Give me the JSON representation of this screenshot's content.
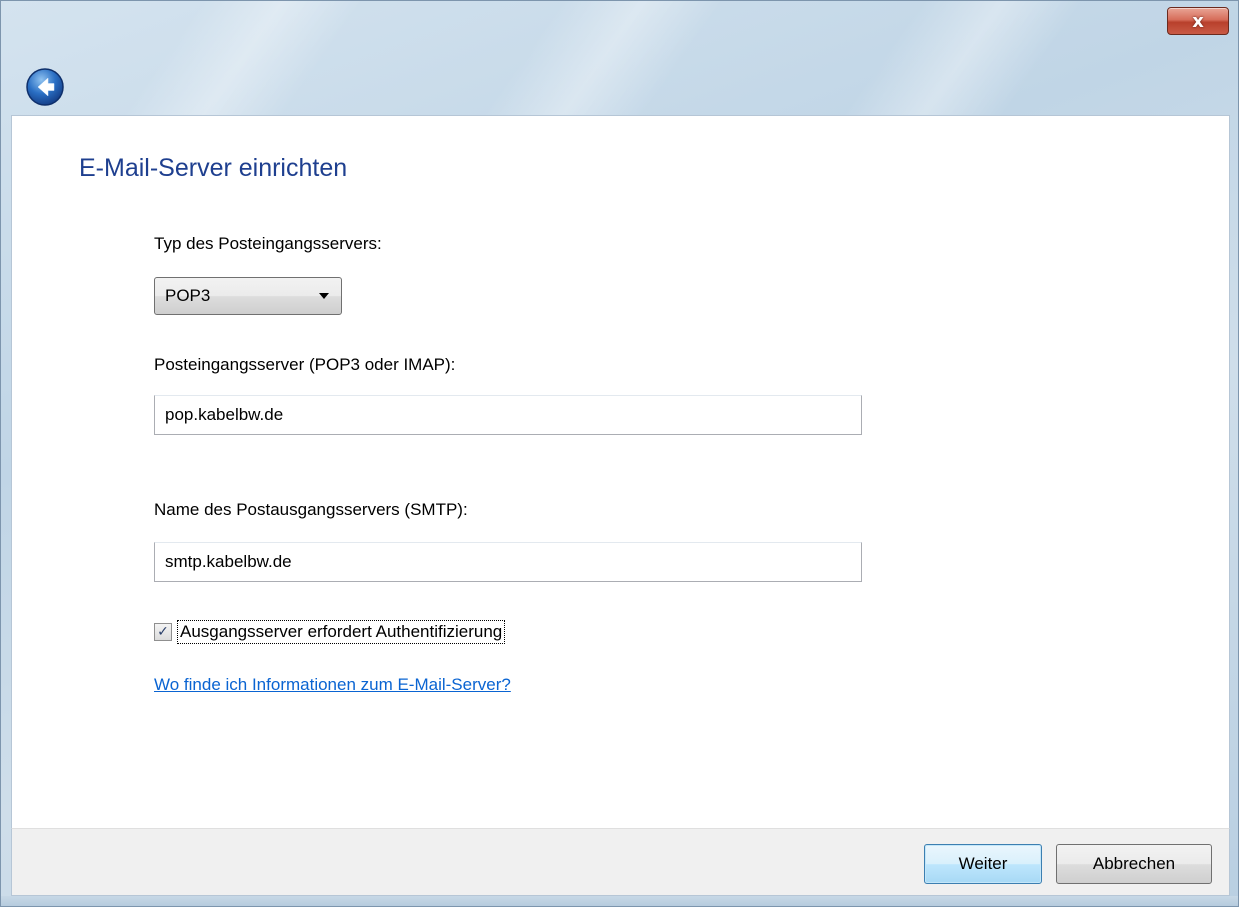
{
  "window": {
    "close_glyph": "x"
  },
  "page": {
    "title": "E-Mail-Server einrichten"
  },
  "form": {
    "incoming_type_label": "Typ des Posteingangsservers:",
    "incoming_type_value": "POP3",
    "incoming_server_label": "Posteingangsserver (POP3 oder IMAP):",
    "incoming_server_value": "pop.kabelbw.de",
    "outgoing_server_label": "Name des Postausgangsservers (SMTP):",
    "outgoing_server_value": "smtp.kabelbw.de",
    "auth_checkbox_label": "Ausgangsserver erfordert Authentifizierung",
    "auth_checkbox_checked": true,
    "auth_check_glyph": "✓",
    "help_link": "Wo finde ich Informationen zum E-Mail-Server?"
  },
  "footer": {
    "next_label": "Weiter",
    "cancel_label": "Abbrechen"
  },
  "icons": {
    "back": "back-arrow-icon",
    "close": "close-icon",
    "dropdown": "chevron-down-icon",
    "check": "checkmark-icon"
  },
  "colors": {
    "title": "#1e3f8f",
    "link": "#0a64d2",
    "close_button": "#c95a45"
  }
}
